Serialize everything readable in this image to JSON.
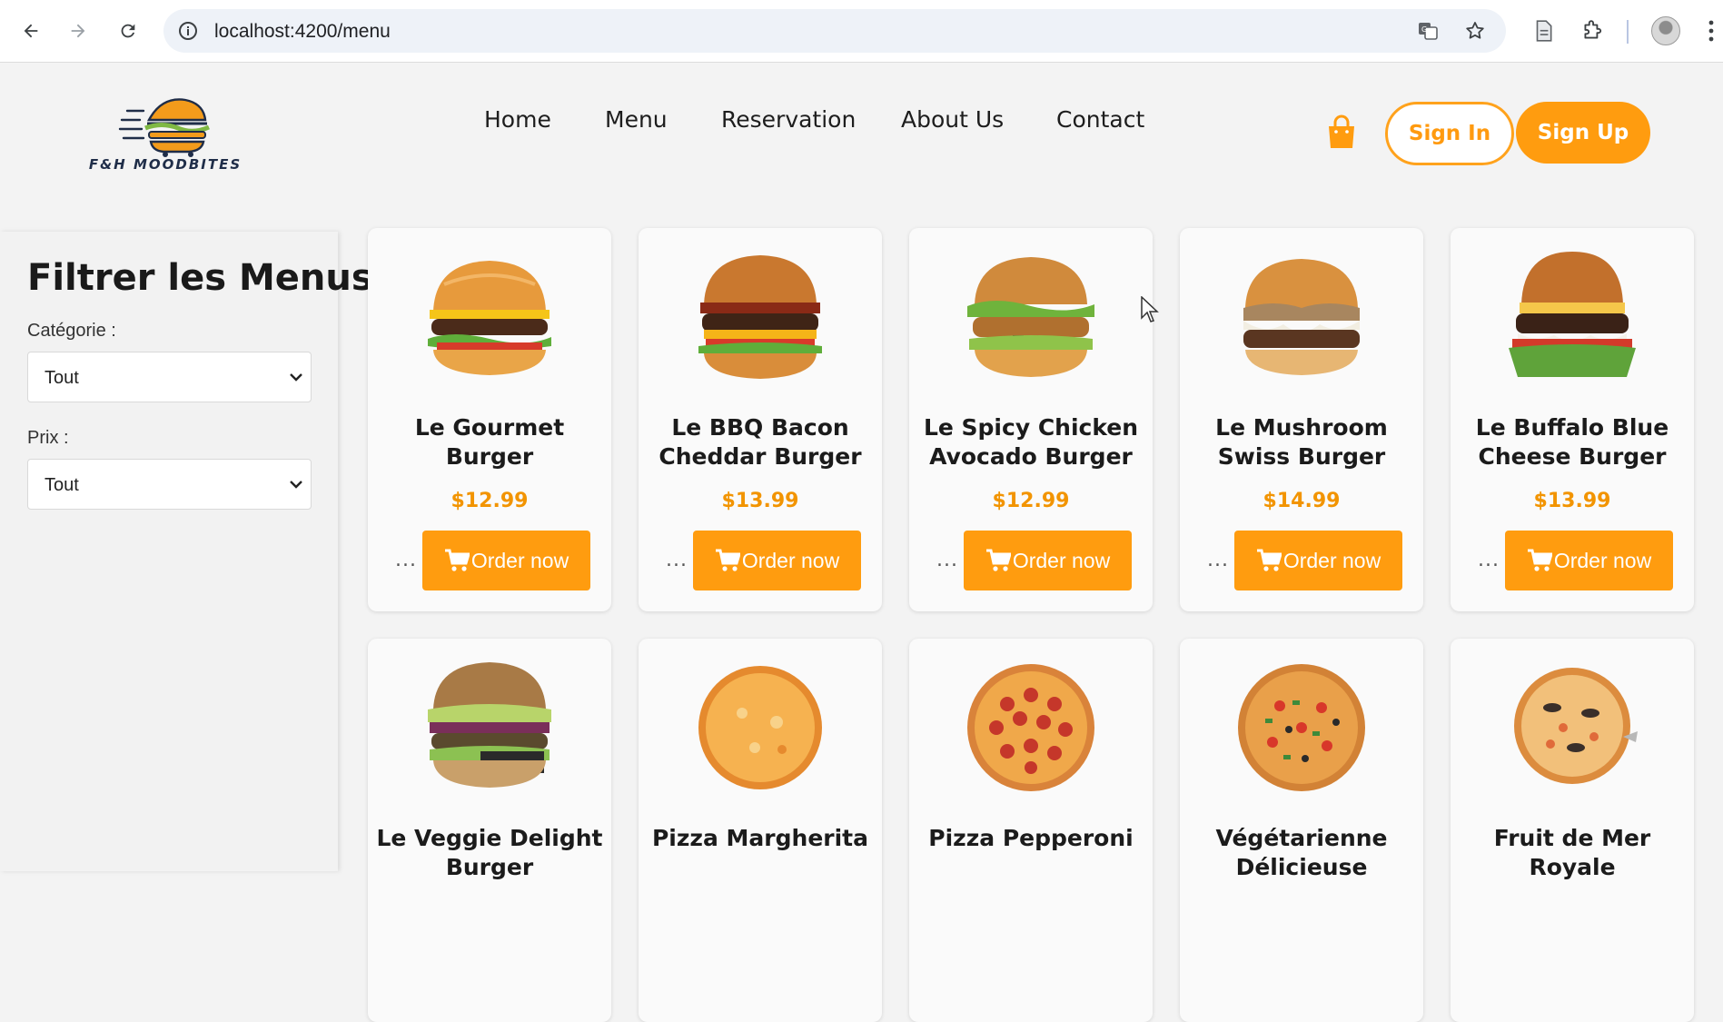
{
  "browser": {
    "url": "localhost:4200/menu",
    "icons": [
      "back-icon",
      "forward-icon",
      "reload-icon",
      "site-info-icon",
      "translate-icon",
      "bookmark-star-icon",
      "reading-list-icon",
      "extensions-icon",
      "profile-avatar",
      "more-menu-icon"
    ]
  },
  "site": {
    "logo_text": "F&H MOODBITES",
    "nav": [
      "Home",
      "Menu",
      "Reservation",
      "About Us",
      "Contact"
    ],
    "sign_in": "Sign In",
    "sign_up": "Sign Up",
    "accent_color": "#ff9c0f"
  },
  "filters": {
    "title": "Filtrer les Menus",
    "category_label": "Catégorie :",
    "category_value": "Tout",
    "price_label": "Prix :",
    "price_value": "Tout"
  },
  "products": [
    {
      "name": "Le Gourmet Burger",
      "price": "$12.99",
      "more": "...",
      "order": "Order now",
      "kind": "burger"
    },
    {
      "name": "Le BBQ Bacon Cheddar Burger",
      "price": "$13.99",
      "more": "...",
      "order": "Order now",
      "kind": "burger"
    },
    {
      "name": "Le Spicy Chicken Avocado Burger",
      "price": "$12.99",
      "more": "...",
      "order": "Order now",
      "kind": "burger"
    },
    {
      "name": "Le Mushroom Swiss Burger",
      "price": "$14.99",
      "more": "...",
      "order": "Order now",
      "kind": "burger"
    },
    {
      "name": "Le Buffalo Blue Cheese Burger",
      "price": "$13.99",
      "more": "...",
      "order": "Order now",
      "kind": "burger"
    },
    {
      "name": "Le Veggie Delight Burger",
      "kind": "burger"
    },
    {
      "name": "Pizza Margherita",
      "kind": "pizza"
    },
    {
      "name": "Pizza Pepperoni",
      "kind": "pizza"
    },
    {
      "name": "Végétarienne Délicieuse",
      "kind": "pizza"
    },
    {
      "name": "Fruit de Mer Royale",
      "kind": "pizza"
    }
  ]
}
